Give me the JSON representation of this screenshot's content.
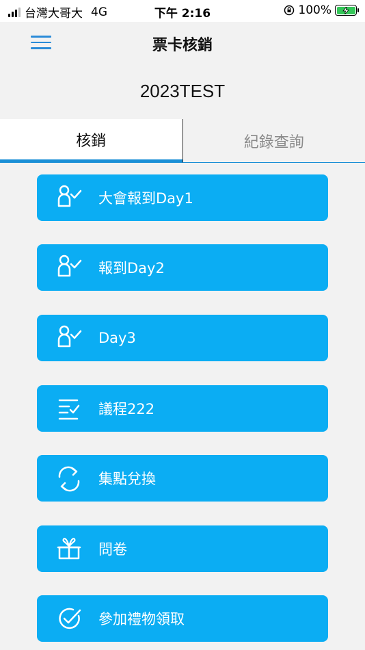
{
  "status_bar": {
    "carrier": "台灣大哥大",
    "network": "4G",
    "time": "下午 2:16",
    "battery": "100%"
  },
  "nav": {
    "title": "票卡核銷",
    "menu_icon": "hamburger-menu-icon"
  },
  "event_name": "2023TEST",
  "tabs": [
    {
      "label": "核銷",
      "active": true
    },
    {
      "label": "紀錄查詢",
      "active": false
    }
  ],
  "actions": [
    {
      "label": "大會報到Day1",
      "icon": "user-check-icon"
    },
    {
      "label": "報到Day2",
      "icon": "user-check-icon"
    },
    {
      "label": "Day3",
      "icon": "user-check-icon"
    },
    {
      "label": "議程222",
      "icon": "checklist-icon"
    },
    {
      "label": "集點兌換",
      "icon": "exchange-arrows-icon"
    },
    {
      "label": "問卷",
      "icon": "gift-icon"
    },
    {
      "label": "參加禮物領取",
      "icon": "clock-check-icon"
    }
  ],
  "colors": {
    "button": "#0badf3",
    "accent": "#1a8fd6",
    "background": "#f2f2f2"
  }
}
